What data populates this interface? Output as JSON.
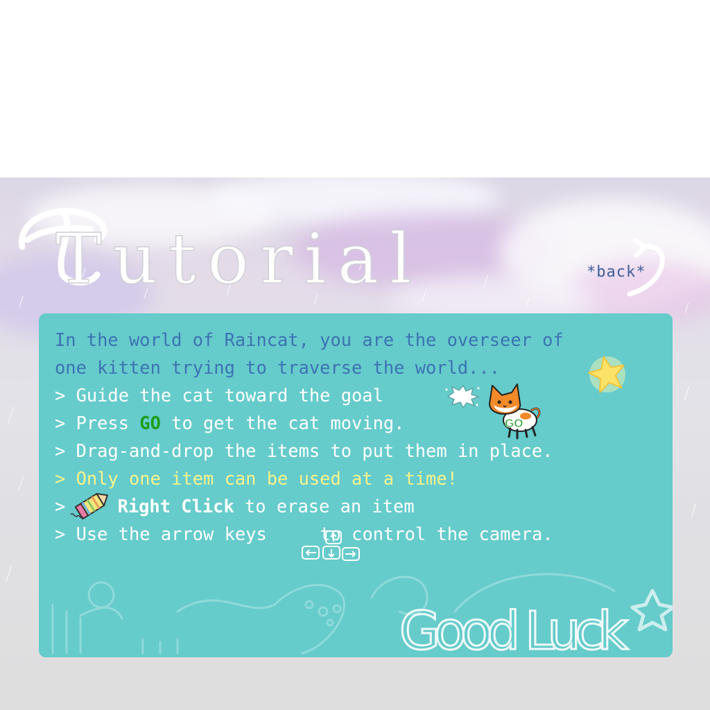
{
  "header": {
    "title": "Tutorial",
    "back_label": "*back*"
  },
  "panel": {
    "intro_line1": "In the world of Raincat, you are the overseer of",
    "intro_line2": "one kitten trying to traverse the world...",
    "items": [
      {
        "prefix": "> ",
        "text": "Guide the cat toward the goal"
      },
      {
        "prefix": "> ",
        "before": "Press ",
        "highlight": "GO",
        "after": " to get the cat moving."
      },
      {
        "prefix": "> ",
        "text": "Drag-and-drop the items to put them in place."
      },
      {
        "prefix": "> ",
        "text": "Only one item can be used at a time!"
      },
      {
        "prefix": "> ",
        "highlight": "Right Click",
        "after": " to erase an item"
      },
      {
        "prefix": "> ",
        "before": "Use the arrow keys ",
        "after": " to control the camera."
      }
    ],
    "cat_go_label": "GO",
    "footer": "Good Luck"
  },
  "colors": {
    "panel": "#66cbcb",
    "text": "#3c73b3",
    "highlight_white": "#ffffff",
    "warning_yellow": "#f6f38c",
    "go_green": "#1d9e1d",
    "back_link": "#3d5f9a"
  },
  "icons": [
    "star-icon",
    "goal-burst-icon",
    "cat-go-icon",
    "pencil-eraser-icon",
    "arrow-keys-icon",
    "back-arrow-icon"
  ]
}
